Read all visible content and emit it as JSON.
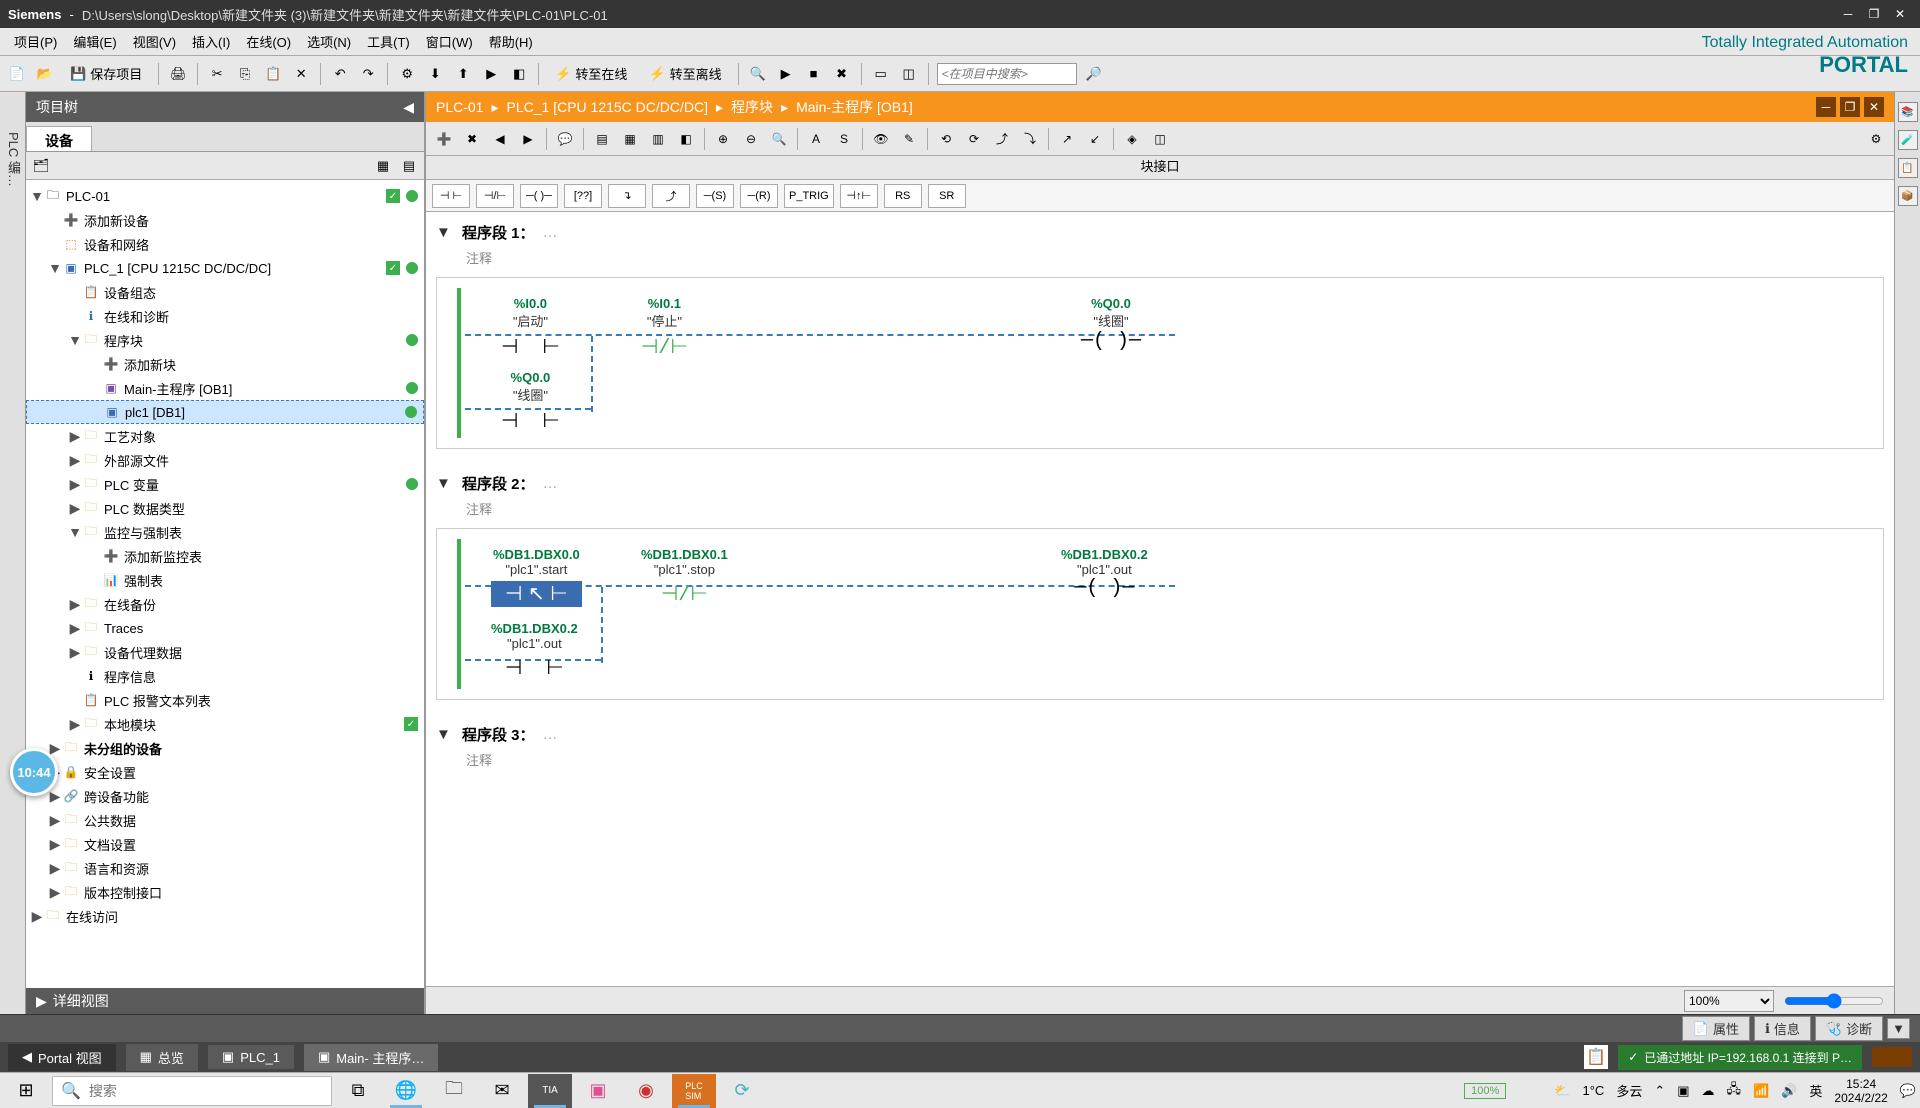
{
  "title": {
    "brand": "Siemens",
    "sep": "-",
    "path": "D:\\Users\\slong\\Desktop\\新建文件夹 (3)\\新建文件夹\\新建文件夹\\新建文件夹\\PLC-01\\PLC-01"
  },
  "menu": {
    "project": "项目(P)",
    "edit": "编辑(E)",
    "view": "视图(V)",
    "insert": "插入(I)",
    "online": "在线(O)",
    "options": "选项(N)",
    "tools": "工具(T)",
    "window": "窗口(W)",
    "help": "帮助(H)"
  },
  "tia": {
    "line1": "Totally Integrated Automation",
    "line2": "PORTAL"
  },
  "toolbar": {
    "save": "保存项目",
    "go_online": "转至在线",
    "go_offline": "转至离线",
    "search_ph": "<在项目中搜索>"
  },
  "left_vtab": "PLC 编…",
  "project_panel": {
    "header": "项目树",
    "tab_device": "设备",
    "detail_view": "详细视图"
  },
  "tree": {
    "root": "PLC-01",
    "add_device": "添加新设备",
    "dev_net": "设备和网络",
    "plc1": "PLC_1 [CPU 1215C DC/DC/DC]",
    "dev_config": "设备组态",
    "online_diag": "在线和诊断",
    "prog_blocks": "程序块",
    "add_block": "添加新块",
    "main_ob": "Main-主程序 [OB1]",
    "plc1_db": "plc1 [DB1]",
    "tech_obj": "工艺对象",
    "ext_src": "外部源文件",
    "plc_tags": "PLC 变量",
    "plc_types": "PLC 数据类型",
    "watch_tables": "监控与强制表",
    "add_watch": "添加新监控表",
    "force_table": "强制表",
    "online_backup": "在线备份",
    "traces": "Traces",
    "proxy_data": "设备代理数据",
    "prog_info": "程序信息",
    "alarm_texts": "PLC 报警文本列表",
    "local_modules": "本地模块",
    "ungrouped": "未分组的设备",
    "security": "安全设置",
    "cross_dev": "跨设备功能",
    "common_data": "公共数据",
    "doc_settings": "文档设置",
    "languages": "语言和资源",
    "version": "版本控制接口",
    "online_access": "在线访问"
  },
  "breadcrumb": {
    "p1": "PLC-01",
    "p2": "PLC_1 [CPU 1215C DC/DC/DC]",
    "p3": "程序块",
    "p4": "Main-主程序 [OB1]"
  },
  "block_if": "块接口",
  "lad_symbols": {
    "no": "⊣ ⊢",
    "nc": "⊣/⊢",
    "coil": "─( )─",
    "box": "[??]",
    "branch": "↴",
    "jump": "⤴",
    "set": "─(S)",
    "reset": "─(R)",
    "ptrig": "P_TRIG",
    "ntrig": "⊣↑⊢",
    "rs": "RS",
    "sr": "SR"
  },
  "net1": {
    "title": "程序段 1：",
    "comment": "注释",
    "c1_addr": "%I0.0",
    "c1_name": "\"启动\"",
    "c2_addr": "%I0.1",
    "c2_name": "\"停止\"",
    "out_addr": "%Q0.0",
    "out_name": "\"线圈\"",
    "c3_addr": "%Q0.0",
    "c3_name": "\"线圈\""
  },
  "net2": {
    "title": "程序段 2：",
    "comment": "注释",
    "c1_addr": "%DB1.DBX0.0",
    "c1_name": "\"plc1\".start",
    "c2_addr": "%DB1.DBX0.1",
    "c2_name": "\"plc1\".stop",
    "out_addr": "%DB1.DBX0.2",
    "out_name": "\"plc1\".out",
    "c3_addr": "%DB1.DBX0.2",
    "c3_name": "\"plc1\".out"
  },
  "net3": {
    "title": "程序段 3：",
    "comment": "注释"
  },
  "zoom": "100%",
  "inspector": {
    "properties": "属性",
    "info": "信息",
    "diag": "诊断"
  },
  "bottom": {
    "portal": "Portal 视图",
    "overview": "总览",
    "plc1": "PLC_1",
    "main": "Main- 主程序…",
    "conn": "已通过地址 IP=192.168.0.1 连接到 P…"
  },
  "taskbar": {
    "search_ph": "搜索",
    "battery": "100%",
    "weather_temp": "1°C",
    "weather_txt": "多云",
    "ime": "英",
    "time": "15:24",
    "date": "2024/2/22"
  },
  "badge_time": "10:44"
}
